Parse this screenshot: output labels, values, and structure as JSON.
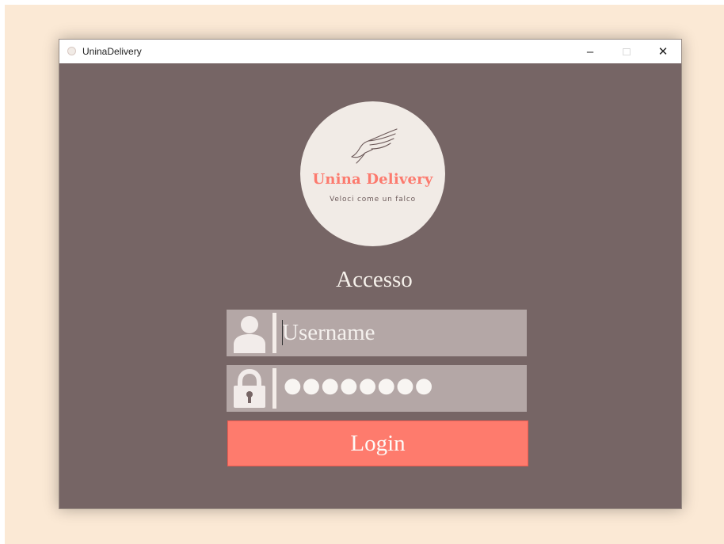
{
  "window": {
    "title": "UninaDelivery",
    "controls": {
      "minimize": "–",
      "maximize": "□",
      "close": "✕"
    }
  },
  "logo": {
    "name": "Unina Delivery",
    "tagline": "Veloci come un falco",
    "icon": "falcon-wing-icon"
  },
  "login": {
    "heading": "Accesso",
    "username": {
      "placeholder": "Username",
      "value": "",
      "icon": "user-icon"
    },
    "password": {
      "masked_value": "●●●●●●●●",
      "icon": "lock-icon"
    },
    "button_label": "Login"
  },
  "colors": {
    "window_bg": "#766565",
    "field_bg": "#b4a7a6",
    "accent": "#fe7b6d",
    "logo_bg": "#f1ebe6",
    "backdrop": "#fbe9d5"
  }
}
